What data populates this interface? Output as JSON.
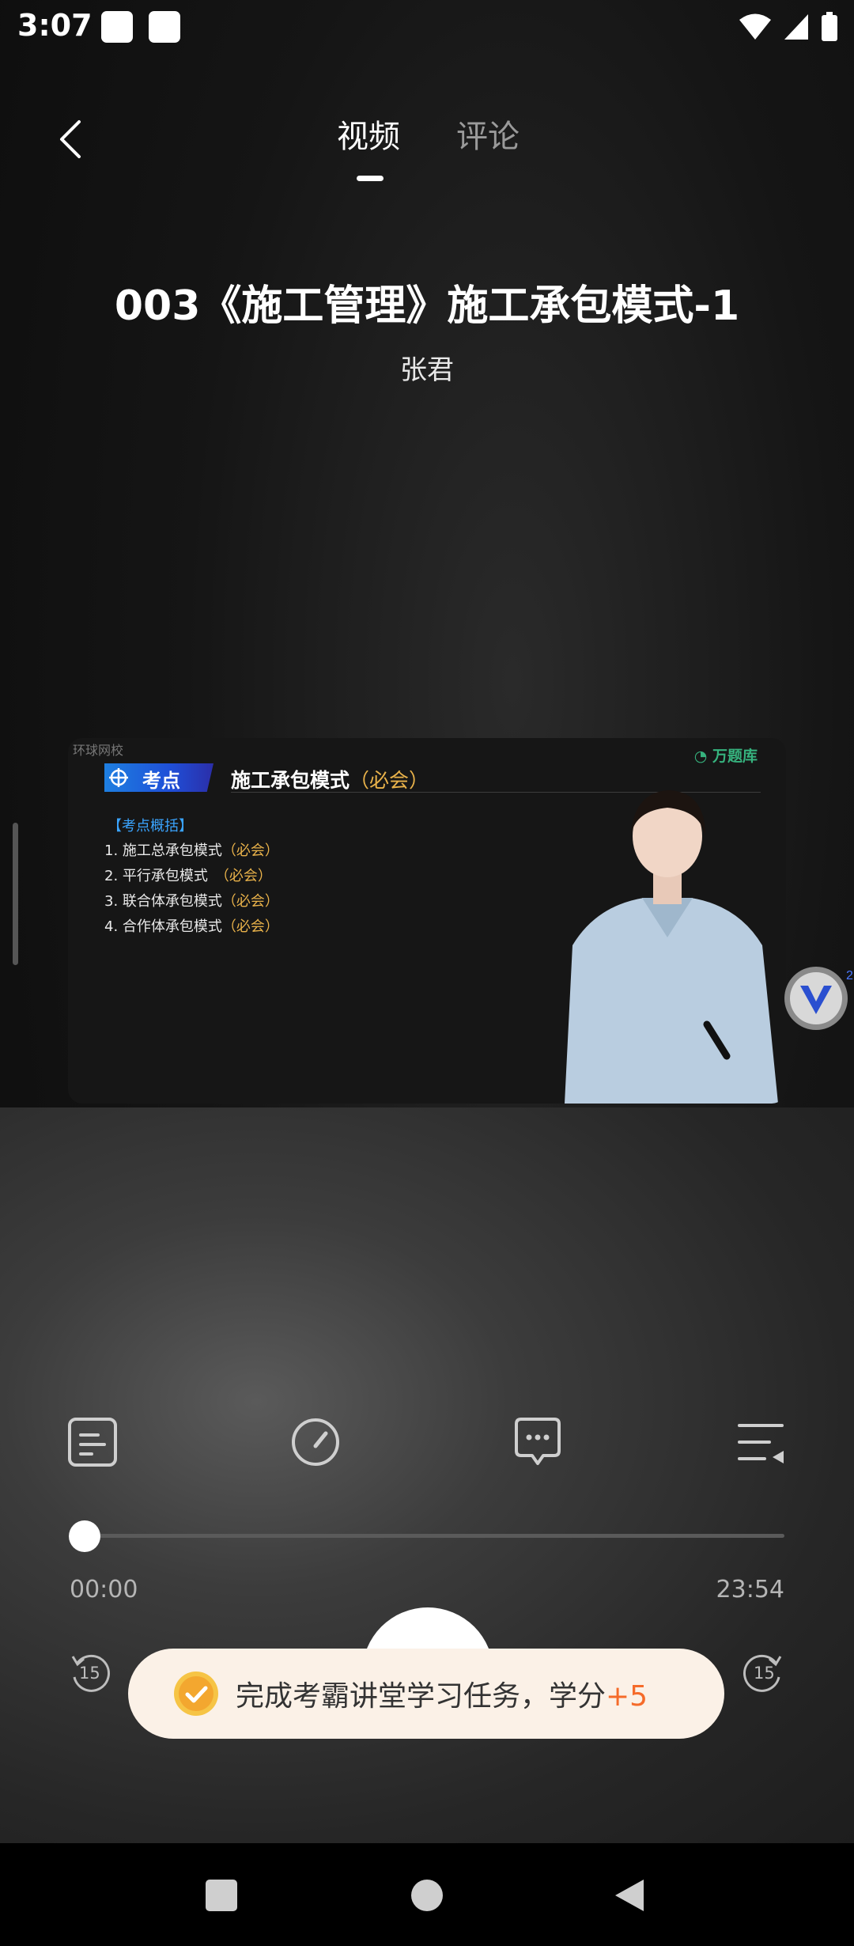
{
  "status_bar": {
    "time": "3:07"
  },
  "tabs": [
    {
      "label": "视频",
      "active": true
    },
    {
      "label": "评论",
      "active": false
    }
  ],
  "course": {
    "title": "003《施工管理》施工承包模式-1",
    "teacher": "张君"
  },
  "video": {
    "watermark": "环球网校",
    "brand": "万题库",
    "badge": "考点",
    "slide_title": "施工承包模式",
    "slide_title_note": "（必会）",
    "outline_heading": "【考点概括】",
    "points": [
      {
        "text": "1. 施工总承包模式",
        "note": "（必会）"
      },
      {
        "text": "2. 平行承包模式　",
        "note": "（必会）"
      },
      {
        "text": "3. 联合体承包模式",
        "note": "（必会）"
      },
      {
        "text": "4. 合作体承包模式",
        "note": "（必会）"
      }
    ]
  },
  "controls": {
    "icons": [
      "notes-icon",
      "speed-icon",
      "comment-icon",
      "playlist-icon"
    ],
    "current_time": "00:00",
    "total_time": "23:54",
    "progress": 0,
    "rewind_label": "15",
    "forward_label": "15"
  },
  "toast": {
    "text": "完成考霸讲堂学习任务，学分",
    "points": "+5"
  },
  "colors": {
    "accent": "#f56b2a",
    "toast_bg": "#fbf1e7",
    "highlight": "#e9b24a"
  }
}
